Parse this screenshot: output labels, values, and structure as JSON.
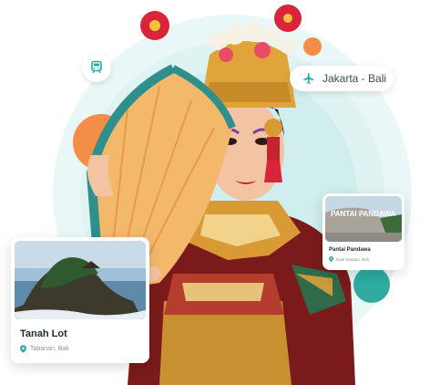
{
  "route_chip": {
    "label": "Jakarta - Bali",
    "icon": "airplane-icon"
  },
  "train_chip": {
    "icon": "train-icon"
  },
  "cards": [
    {
      "title": "Tanah Lot",
      "location": "Tabanan, Bali",
      "icon": "location-pin-icon"
    },
    {
      "title": "Pantai Pandawa",
      "location": "Kuta Selatan, Bali",
      "photo_sign": "PANTAI PANDAWA",
      "icon": "location-pin-icon"
    }
  ],
  "colors": {
    "teal": "#2eaaa0",
    "orange": "#f48d45",
    "ring": "#cfeeed"
  }
}
